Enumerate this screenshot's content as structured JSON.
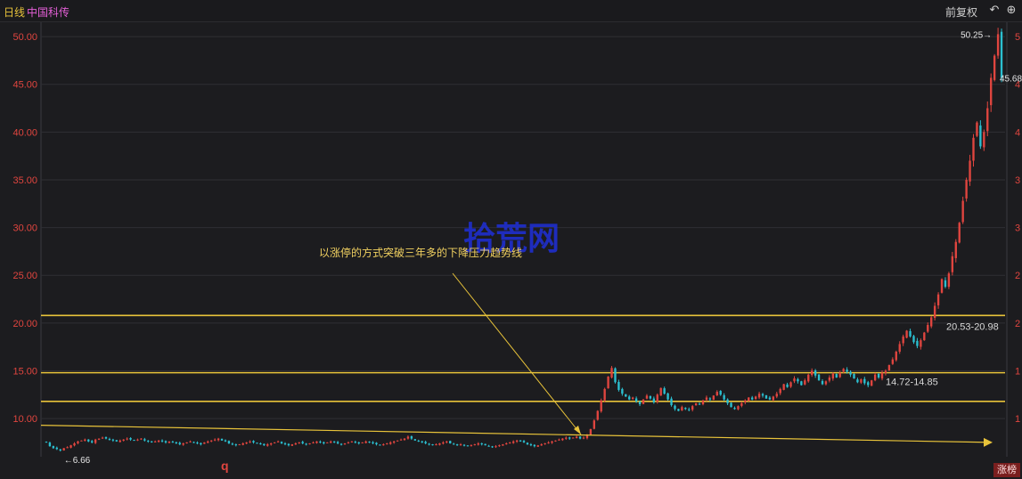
{
  "header": {
    "period": "日线",
    "stock_name": "中国科传",
    "adjust_label": "前复权",
    "icons": [
      "undo-icon",
      "plus-circle-icon"
    ]
  },
  "watermark": "拾荒网",
  "annotation": "以涨停的方式突破三年多的下降压力趋势线",
  "bottom_marker": "q",
  "corner_badge": "涨榜",
  "colors": {
    "up": "#e0453f",
    "down": "#2bbfd0",
    "trend": "#e8c33a",
    "grid": "#2f2f34"
  },
  "chart_data": {
    "type": "candlestick",
    "title": "",
    "xlabel": "",
    "ylabel": "",
    "ylim": [
      6,
      51.5
    ],
    "y_ticks": [
      10,
      15,
      20,
      25,
      30,
      35,
      40,
      45,
      50
    ],
    "y_tick_labels": [
      "10.00",
      "15.00",
      "20.00",
      "25.00",
      "30.00",
      "35.00",
      "40.00",
      "45.00",
      "50.00"
    ],
    "right_tick_labels": [
      "1",
      "1",
      "2",
      "2",
      "3",
      "3",
      "4",
      "4",
      "5"
    ],
    "grid": true,
    "resistance_levels": [
      {
        "price": 20.8,
        "label": "20.53-20.98"
      },
      {
        "price": 14.8,
        "label": "14.72-14.85"
      },
      {
        "price": 11.8,
        "label": ""
      }
    ],
    "trendline": {
      "from_price": 9.3,
      "to_price": 7.5
    },
    "low_label": "6.66",
    "high_label": "50.25",
    "last_label": "45.68",
    "closes": [
      7.5,
      7.1,
      6.9,
      6.8,
      6.66,
      6.9,
      7.0,
      7.2,
      7.4,
      7.6,
      7.7,
      7.8,
      7.6,
      7.5,
      7.8,
      7.9,
      8.0,
      7.9,
      7.8,
      7.7,
      7.6,
      7.7,
      7.8,
      7.9,
      7.8,
      7.7,
      7.8,
      7.9,
      7.7,
      7.6,
      7.5,
      7.6,
      7.7,
      7.6,
      7.5,
      7.6,
      7.5,
      7.4,
      7.3,
      7.4,
      7.5,
      7.6,
      7.5,
      7.4,
      7.3,
      7.5,
      7.6,
      7.7,
      7.8,
      7.9,
      7.7,
      7.6,
      7.4,
      7.3,
      7.2,
      7.3,
      7.4,
      7.5,
      7.6,
      7.5,
      7.4,
      7.3,
      7.2,
      7.3,
      7.4,
      7.5,
      7.6,
      7.4,
      7.3,
      7.2,
      7.3,
      7.4,
      7.5,
      7.4,
      7.3,
      7.4,
      7.5,
      7.6,
      7.5,
      7.4,
      7.5,
      7.6,
      7.5,
      7.4,
      7.3,
      7.4,
      7.5,
      7.6,
      7.5,
      7.4,
      7.5,
      7.6,
      7.5,
      7.4,
      7.3,
      7.2,
      7.3,
      7.4,
      7.5,
      7.6,
      7.7,
      7.8,
      7.9,
      8.1,
      7.9,
      7.7,
      7.6,
      7.5,
      7.4,
      7.3,
      7.2,
      7.3,
      7.4,
      7.5,
      7.6,
      7.4,
      7.3,
      7.2,
      7.3,
      7.2,
      7.1,
      7.2,
      7.3,
      7.4,
      7.3,
      7.2,
      7.1,
      7.0,
      7.1,
      7.2,
      7.3,
      7.4,
      7.5,
      7.6,
      7.7,
      7.6,
      7.5,
      7.3,
      7.2,
      7.1,
      7.2,
      7.3,
      7.4,
      7.5,
      7.6,
      7.7,
      7.8,
      7.9,
      8.0,
      7.9,
      8.0,
      8.1,
      7.9,
      8.0,
      8.3,
      8.9,
      9.8,
      10.8,
      11.9,
      13.1,
      14.4,
      15.3,
      13.8,
      13.0,
      12.6,
      12.3,
      12.0,
      12.2,
      11.8,
      11.5,
      12.0,
      12.4,
      12.1,
      11.7,
      12.5,
      13.2,
      12.6,
      12.0,
      11.4,
      11.0,
      10.8,
      11.2,
      11.0,
      10.9,
      11.3,
      11.6,
      11.5,
      11.9,
      12.2,
      12.0,
      12.4,
      12.8,
      12.5,
      12.0,
      11.6,
      11.2,
      11.0,
      11.3,
      11.6,
      11.9,
      12.2,
      12.0,
      12.3,
      12.6,
      12.4,
      12.1,
      12.0,
      12.3,
      12.6,
      13.1,
      13.6,
      13.3,
      13.8,
      14.2,
      13.9,
      13.5,
      14.0,
      14.6,
      15.0,
      14.5,
      14.0,
      13.6,
      13.9,
      14.3,
      14.7,
      14.3,
      14.8,
      15.2,
      14.9,
      14.6,
      14.2,
      13.8,
      14.1,
      13.7,
      13.5,
      14.0,
      14.6,
      14.3,
      14.8,
      15.0,
      15.6,
      16.2,
      17.0,
      17.8,
      18.6,
      19.2,
      18.6,
      18.0,
      17.6,
      18.2,
      19.0,
      19.8,
      20.6,
      21.8,
      23.0,
      24.6,
      23.8,
      25.2,
      27.0,
      28.5,
      30.5,
      32.8,
      35.0,
      37.0,
      39.4,
      41.0,
      38.5,
      40.0,
      42.5,
      45.68,
      48.0,
      50.25,
      45.68
    ],
    "candle_count": 260
  }
}
